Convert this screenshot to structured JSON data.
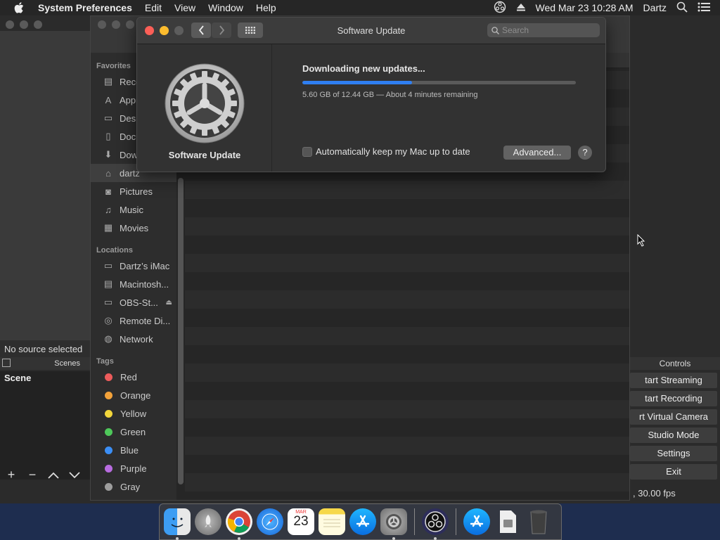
{
  "menubar": {
    "app_name": "System Preferences",
    "menus": [
      "Edit",
      "View",
      "Window",
      "Help"
    ],
    "clock": "Wed Mar 23  10:28 AM",
    "user": "Dartz"
  },
  "software_update": {
    "window_title": "Software Update",
    "search_placeholder": "Search",
    "pane_name": "Software Update",
    "status": "Downloading new updates...",
    "progress_fraction": 0.4,
    "progress_detail": "5.60 GB of 12.44 GB — About 4 minutes remaining",
    "auto_update_label": "Automatically keep my Mac up to date",
    "auto_update_checked": false,
    "advanced_label": "Advanced...",
    "help_label": "?"
  },
  "finder": {
    "favorites_header": "Favorites",
    "favorites": [
      "Rece",
      "Appl",
      "Desk",
      "Docu",
      "Dow",
      "dartz",
      "Pictures",
      "Music",
      "Movies"
    ],
    "locations_header": "Locations",
    "locations": [
      "Dartz’s iMac",
      "Macintosh...",
      "OBS-St...",
      "Remote Di...",
      "Network"
    ],
    "tags_header": "Tags",
    "tags": [
      {
        "name": "Red",
        "color": "#ec5b5b"
      },
      {
        "name": "Orange",
        "color": "#f3a23a"
      },
      {
        "name": "Yellow",
        "color": "#f2d63b"
      },
      {
        "name": "Green",
        "color": "#4ec85a"
      },
      {
        "name": "Blue",
        "color": "#3b8ef5"
      },
      {
        "name": "Purple",
        "color": "#b86ce0"
      },
      {
        "name": "Gray",
        "color": "#9d9d9d"
      }
    ]
  },
  "obs": {
    "no_source": "No source selected",
    "scenes_header": "Scenes",
    "scene": "Scene",
    "controls_header": "Controls",
    "controls": [
      "tart Streaming",
      "tart Recording",
      "rt Virtual Camera",
      "Studio Mode",
      "Settings",
      "Exit"
    ],
    "fps": ", 30.00 fps"
  },
  "dock": {
    "calendar_month": "MAR",
    "calendar_day": "23"
  }
}
